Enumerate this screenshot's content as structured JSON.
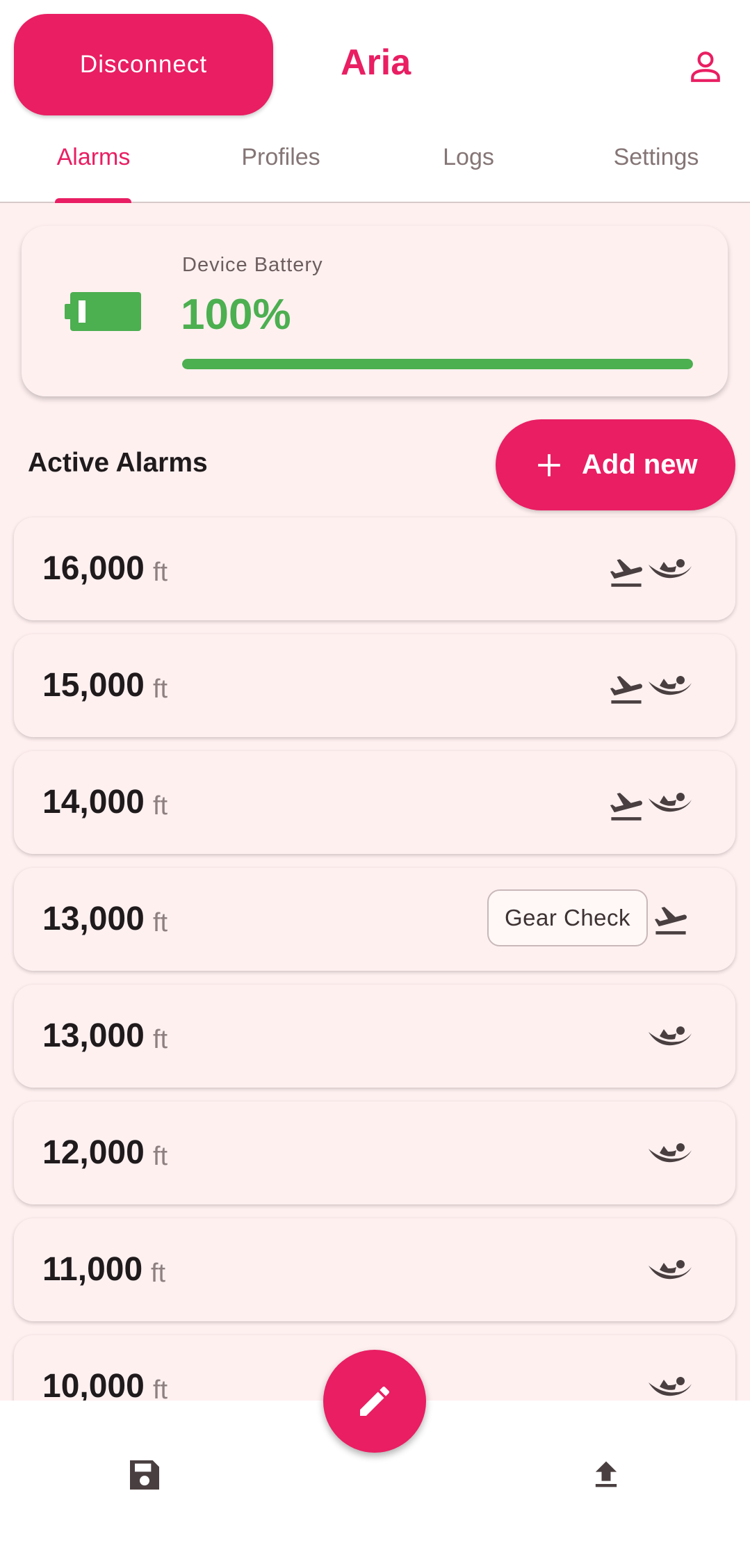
{
  "header": {
    "disconnect_label": "Disconnect",
    "title": "Aria",
    "account_icon": "account-icon"
  },
  "tabs": [
    {
      "label": "Alarms",
      "active": true
    },
    {
      "label": "Profiles",
      "active": false
    },
    {
      "label": "Logs",
      "active": false
    },
    {
      "label": "Settings",
      "active": false
    }
  ],
  "battery": {
    "label": "Device Battery",
    "value": "100%",
    "level": 1.0,
    "color": "#4caf50"
  },
  "alarms_section": {
    "title": "Active Alarms",
    "add_label": "Add new"
  },
  "alarms": [
    {
      "altitude": "16,000",
      "unit": "ft",
      "chip": null,
      "plane": true,
      "freefall": true
    },
    {
      "altitude": "15,000",
      "unit": "ft",
      "chip": null,
      "plane": true,
      "freefall": true
    },
    {
      "altitude": "14,000",
      "unit": "ft",
      "chip": null,
      "plane": true,
      "freefall": true
    },
    {
      "altitude": "13,000",
      "unit": "ft",
      "chip": "Gear Check",
      "plane": true,
      "freefall": false
    },
    {
      "altitude": "13,000",
      "unit": "ft",
      "chip": null,
      "plane": false,
      "freefall": true
    },
    {
      "altitude": "12,000",
      "unit": "ft",
      "chip": null,
      "plane": false,
      "freefall": true
    },
    {
      "altitude": "11,000",
      "unit": "ft",
      "chip": null,
      "plane": false,
      "freefall": true
    },
    {
      "altitude": "10,000",
      "unit": "ft",
      "chip": null,
      "plane": false,
      "freefall": true
    }
  ],
  "bottom_bar": {
    "save_icon": "save-icon",
    "edit_icon": "pencil-icon",
    "upload_icon": "upload-icon"
  },
  "colors": {
    "accent": "#e91e63",
    "battery": "#4caf50",
    "background": "#fff0f0"
  }
}
